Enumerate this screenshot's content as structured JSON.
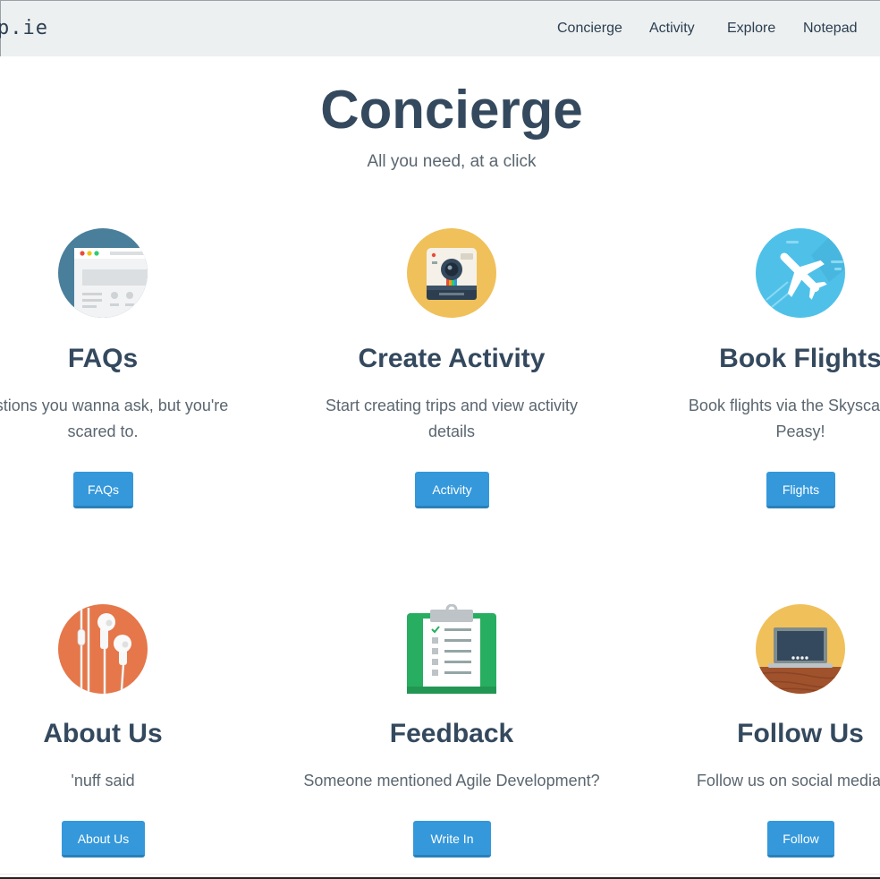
{
  "navbar": {
    "brand": "p.ie",
    "links": [
      "Concierge",
      "Activity",
      "Explore",
      "Notepad"
    ]
  },
  "header": {
    "title": "Concierge",
    "subtitle": "All you need, at a click"
  },
  "cards": [
    {
      "title": "FAQs",
      "description_lines": [
        "uestions you wanna ask, but you're",
        "scared to."
      ],
      "button": "FAQs",
      "icon": "browser-window-icon"
    },
    {
      "title": "Create Activity",
      "description_lines": [
        "Start creating trips and view activity",
        "details"
      ],
      "button": "Activity",
      "icon": "instant-camera-icon"
    },
    {
      "title": "Book Flights",
      "description_lines": [
        "Book flights via the Skyscanner",
        "Peasy!"
      ],
      "button": "Flights",
      "icon": "airplane-icon"
    },
    {
      "title": "About Us",
      "description_lines": [
        "'nuff said"
      ],
      "button": "About Us",
      "icon": "earphones-icon"
    },
    {
      "title": "Feedback",
      "description_lines": [
        "Someone mentioned Agile Development?"
      ],
      "button": "Write In",
      "icon": "clipboard-checklist-icon"
    },
    {
      "title": "Follow Us",
      "description_lines": [
        "Follow us on social media for"
      ],
      "button": "Follow",
      "icon": "laptop-on-desk-icon"
    }
  ],
  "colors": {
    "navbar_bg": "#ecf0f1",
    "heading": "#34495e",
    "button": "#3498db",
    "button_shadow": "#2a80b9"
  }
}
